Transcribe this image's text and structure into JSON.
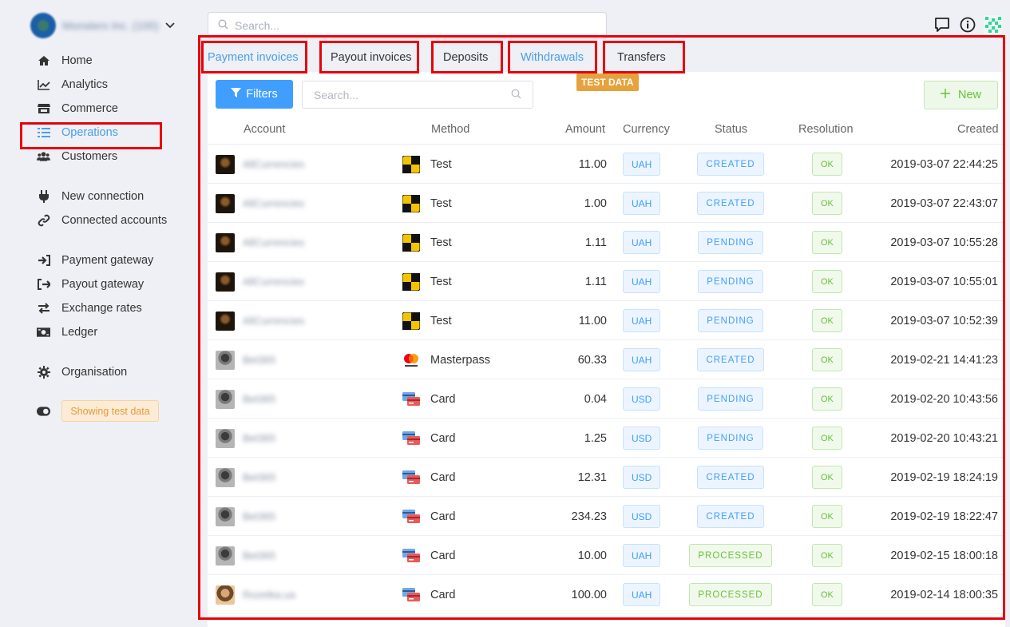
{
  "org": {
    "name": "Monsters Inc. (100)"
  },
  "nav": [
    {
      "key": "home",
      "label": "Home",
      "icon": "home-icon"
    },
    {
      "key": "analytics",
      "label": "Analytics",
      "icon": "chart-line-icon"
    },
    {
      "key": "commerce",
      "label": "Commerce",
      "icon": "store-icon"
    },
    {
      "key": "operations",
      "label": "Operations",
      "icon": "list-icon",
      "active": true
    },
    {
      "key": "customers",
      "label": "Customers",
      "icon": "users-icon"
    },
    {
      "key": "new-connection",
      "label": "New connection",
      "icon": "plug-icon"
    },
    {
      "key": "connected-accounts",
      "label": "Connected accounts",
      "icon": "link-icon"
    },
    {
      "key": "payment-gateway",
      "label": "Payment gateway",
      "icon": "sign-in-icon"
    },
    {
      "key": "payout-gateway",
      "label": "Payout gateway",
      "icon": "sign-out-icon"
    },
    {
      "key": "exchange-rates",
      "label": "Exchange rates",
      "icon": "exchange-icon"
    },
    {
      "key": "ledger",
      "label": "Ledger",
      "icon": "money-icon"
    },
    {
      "key": "organisation",
      "label": "Organisation",
      "icon": "gear-icon"
    }
  ],
  "test_badge": "Showing test data",
  "top_search": {
    "placeholder": "Search..."
  },
  "tabs": [
    {
      "label": "Payment invoices",
      "active": true
    },
    {
      "label": "Payout invoices"
    },
    {
      "label": "Deposits"
    },
    {
      "label": "Withdrawals"
    },
    {
      "label": "Transfers"
    }
  ],
  "test_data_label": "TEST DATA",
  "toolbar": {
    "filters": "Filters",
    "search_placeholder": "Search...",
    "new": "New"
  },
  "columns": {
    "account": "Account",
    "method": "Method",
    "amount": "Amount",
    "currency": "Currency",
    "status": "Status",
    "resolution": "Resolution",
    "created": "Created"
  },
  "rows": [
    {
      "account": "AllCurrencies",
      "method": "Test",
      "amount": "11.00",
      "currency": "UAH",
      "status": "CREATED",
      "resolution": "OK",
      "created": "2019-03-07 22:44:25"
    },
    {
      "account": "AllCurrencies",
      "method": "Test",
      "amount": "1.00",
      "currency": "UAH",
      "status": "CREATED",
      "resolution": "OK",
      "created": "2019-03-07 22:43:07"
    },
    {
      "account": "AllCurrencies",
      "method": "Test",
      "amount": "1.11",
      "currency": "UAH",
      "status": "PENDING",
      "resolution": "OK",
      "created": "2019-03-07 10:55:28"
    },
    {
      "account": "AllCurrencies",
      "method": "Test",
      "amount": "1.11",
      "currency": "UAH",
      "status": "PENDING",
      "resolution": "OK",
      "created": "2019-03-07 10:55:01"
    },
    {
      "account": "AllCurrencies",
      "method": "Test",
      "amount": "11.00",
      "currency": "UAH",
      "status": "PENDING",
      "resolution": "OK",
      "created": "2019-03-07 10:52:39"
    },
    {
      "account": "Bet365",
      "method": "Masterpass",
      "amount": "60.33",
      "currency": "UAH",
      "status": "CREATED",
      "resolution": "OK",
      "created": "2019-02-21 14:41:23"
    },
    {
      "account": "Bet365",
      "method": "Card",
      "amount": "0.04",
      "currency": "USD",
      "status": "PENDING",
      "resolution": "OK",
      "created": "2019-02-20 10:43:56"
    },
    {
      "account": "Bet365",
      "method": "Card",
      "amount": "1.25",
      "currency": "USD",
      "status": "PENDING",
      "resolution": "OK",
      "created": "2019-02-20 10:43:21"
    },
    {
      "account": "Bet365",
      "method": "Card",
      "amount": "12.31",
      "currency": "USD",
      "status": "CREATED",
      "resolution": "OK",
      "created": "2019-02-19 18:24:19"
    },
    {
      "account": "Bet365",
      "method": "Card",
      "amount": "234.23",
      "currency": "USD",
      "status": "CREATED",
      "resolution": "OK",
      "created": "2019-02-19 18:22:47"
    },
    {
      "account": "Bet365",
      "method": "Card",
      "amount": "10.00",
      "currency": "UAH",
      "status": "PROCESSED",
      "resolution": "OK",
      "created": "2019-02-15 18:00:18"
    },
    {
      "account": "Rozetka.ua",
      "method": "Card",
      "amount": "100.00",
      "currency": "UAH",
      "status": "PROCESSED",
      "resolution": "OK",
      "created": "2019-02-14 18:00:35"
    }
  ]
}
